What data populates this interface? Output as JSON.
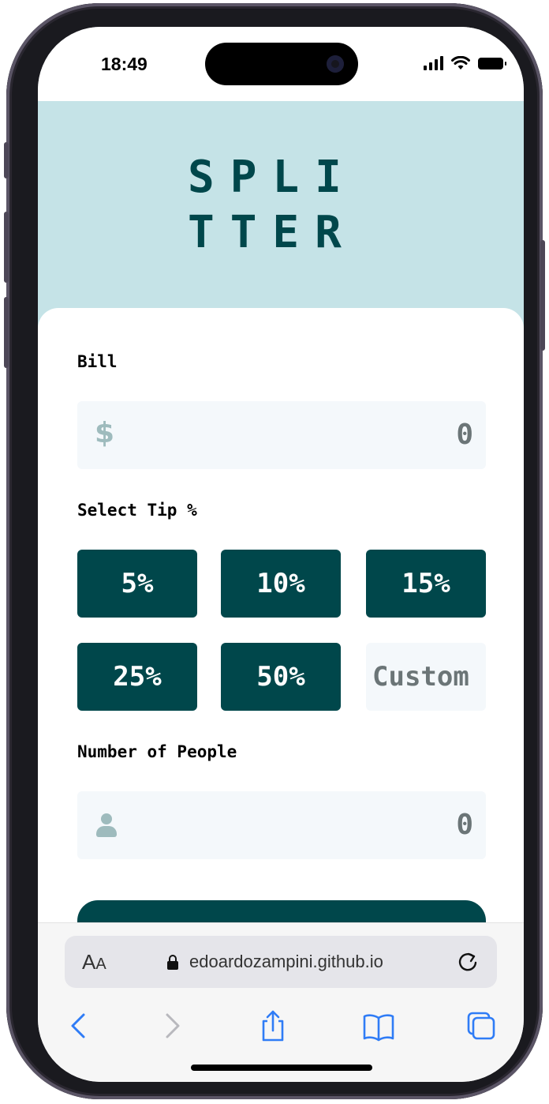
{
  "status_bar": {
    "time": "18:49"
  },
  "app": {
    "logo_line1": "SPLI",
    "logo_line2": "TTER",
    "bill_label": "Bill",
    "bill_prefix": "$",
    "bill_value": "0",
    "tip_label": "Select Tip %",
    "tips": [
      "5%",
      "10%",
      "15%",
      "25%",
      "50%"
    ],
    "custom_placeholder": "Custom",
    "people_label": "Number of People",
    "people_value": "0",
    "colors": {
      "background": "#c5e3e7",
      "primary": "#00474b",
      "field": "#f4f8fb",
      "muted": "#9ebbbd"
    }
  },
  "browser": {
    "aa_large": "A",
    "aa_small": "A",
    "url": "edoardozampini.github.io",
    "nav_icons": [
      "back-icon",
      "forward-icon",
      "share-icon",
      "bookmarks-icon",
      "tabs-icon"
    ]
  }
}
